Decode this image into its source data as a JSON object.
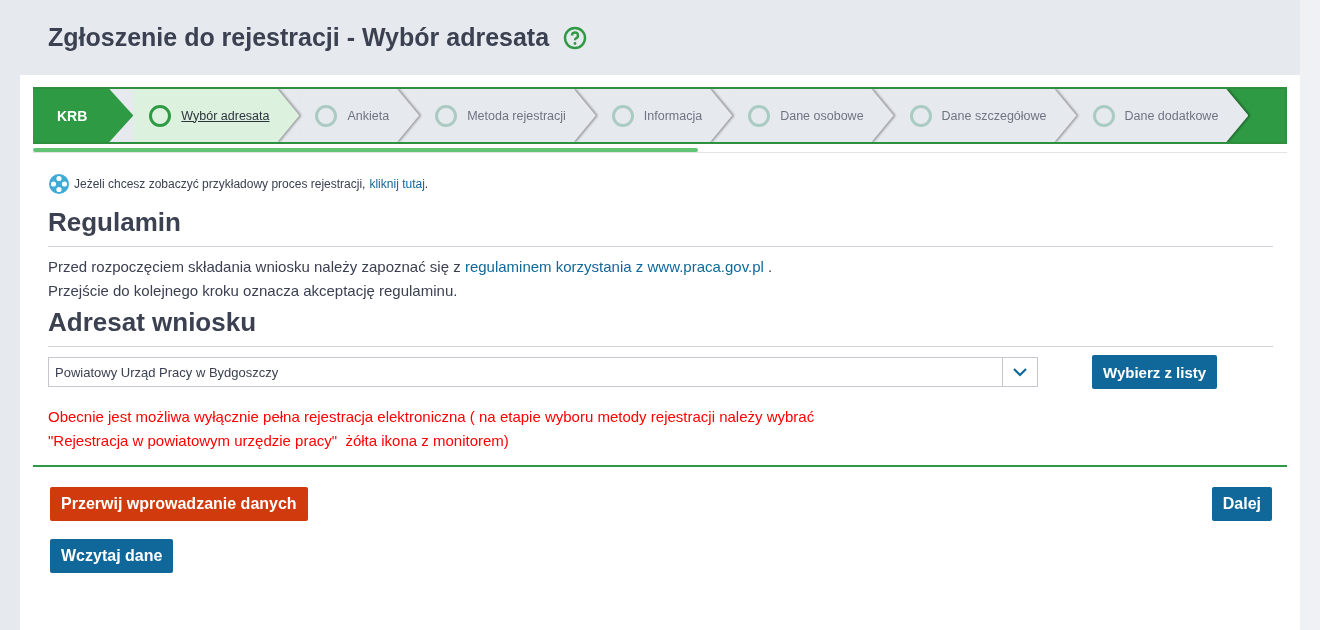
{
  "page_title": "Zgłoszenie do rejestracji - Wybór adresata",
  "wizard": {
    "start_label": "KRB",
    "steps": [
      {
        "label": "Wybór adresata",
        "selected": true
      },
      {
        "label": "Ankieta",
        "selected": false
      },
      {
        "label": "Metoda rejestracji",
        "selected": false
      },
      {
        "label": "Informacja",
        "selected": false
      },
      {
        "label": "Dane osobowe",
        "selected": false
      },
      {
        "label": "Dane szczegółowe",
        "selected": false
      },
      {
        "label": "Dane dodatkowe",
        "selected": false
      }
    ],
    "progress": {
      "level": 0.53
    }
  },
  "demo_note": {
    "text": "Jeżeli chcesz zobaczyć przykładowy proces rejestracji,",
    "link": "kliknij tutaj",
    "end": "."
  },
  "rules": {
    "heading": "Regulamin",
    "line_1": "Przed rozpoczęciem składania wniosku należy zapoznać się z",
    "link": "regulaminem korzystania z www.praca.gov.pl",
    "line_1_end": ".",
    "line_2": "Przejście do kolejnego kroku oznacza akceptację regulaminu."
  },
  "addressee": {
    "heading": "Adresat wniosku",
    "select_value": "Powiatowy Urząd Pracy w Bydgoszczy",
    "pick_button": "Wybierz z listy",
    "warning": [
      "Obecnie jest możliwa wyłącznie pełna rejestracja elektroniczna ( na etapie wyboru metody rejestracji należy wybrać",
      "\"Rejestracja w powiatowym urzędzie pracy\"  żółta ikona z monitorem)"
    ]
  },
  "actions": {
    "abort": "Przerwij wprowadzanie danych",
    "next": "Dalej",
    "load": "Wczytaj dane"
  }
}
